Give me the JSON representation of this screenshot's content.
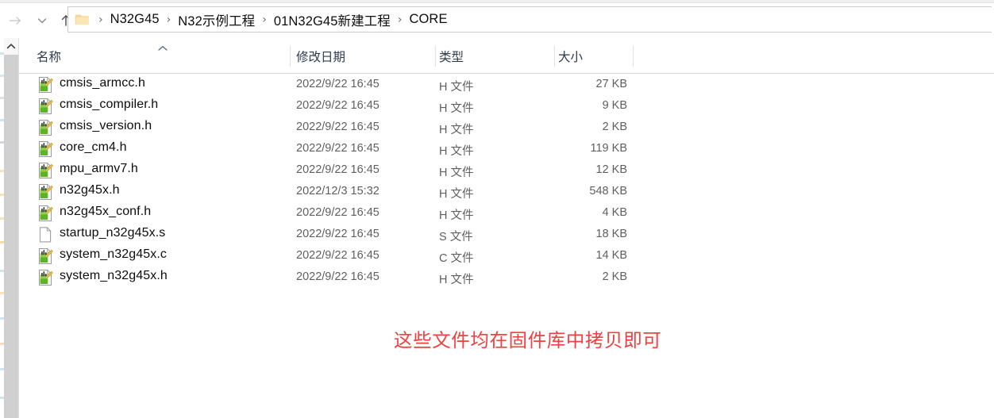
{
  "window": {
    "kind": "windows-file-explorer"
  },
  "toolbar": {
    "back_label": "",
    "forward_label": "",
    "recent_label": "",
    "up_label": "",
    "icons": {
      "forward": "forward-arrow-icon",
      "recent": "chevron-down-icon",
      "up": "up-arrow-icon",
      "folder": "folder-icon"
    }
  },
  "address_bar": {
    "separator": "›",
    "crumbs": [
      {
        "label": "N32G45"
      },
      {
        "label": "N32示例工程"
      },
      {
        "label": "01N32G45新建工程"
      },
      {
        "label": "CORE"
      }
    ]
  },
  "columns": {
    "name": "名称",
    "date_modified": "修改日期",
    "type": "类型",
    "size": "大小",
    "sorted_by": "名称",
    "sort_direction": "ascending"
  },
  "files": [
    {
      "name": "cmsis_armcc.h",
      "date": "2022/9/22 16:45",
      "type": "H 文件",
      "size": "27 KB",
      "icon": "code-file-icon"
    },
    {
      "name": "cmsis_compiler.h",
      "date": "2022/9/22 16:45",
      "type": "H 文件",
      "size": "9 KB",
      "icon": "code-file-icon"
    },
    {
      "name": "cmsis_version.h",
      "date": "2022/9/22 16:45",
      "type": "H 文件",
      "size": "2 KB",
      "icon": "code-file-icon"
    },
    {
      "name": "core_cm4.h",
      "date": "2022/9/22 16:45",
      "type": "H 文件",
      "size": "119 KB",
      "icon": "code-file-icon"
    },
    {
      "name": "mpu_armv7.h",
      "date": "2022/9/22 16:45",
      "type": "H 文件",
      "size": "12 KB",
      "icon": "code-file-icon"
    },
    {
      "name": "n32g45x.h",
      "date": "2022/12/3 15:32",
      "type": "H 文件",
      "size": "548 KB",
      "icon": "code-file-icon"
    },
    {
      "name": "n32g45x_conf.h",
      "date": "2022/9/22 16:45",
      "type": "H 文件",
      "size": "4 KB",
      "icon": "code-file-icon"
    },
    {
      "name": "startup_n32g45x.s",
      "date": "2022/9/22 16:45",
      "type": "S 文件",
      "size": "18 KB",
      "icon": "generic-file-icon"
    },
    {
      "name": "system_n32g45x.c",
      "date": "2022/9/22 16:45",
      "type": "C 文件",
      "size": "14 KB",
      "icon": "code-file-icon"
    },
    {
      "name": "system_n32g45x.h",
      "date": "2022/9/22 16:45",
      "type": "H 文件",
      "size": "2 KB",
      "icon": "code-file-icon"
    }
  ],
  "annotation": {
    "text": "这些文件均在固件库中拷贝即可",
    "color": "#f0403f"
  },
  "colors": {
    "text_primary": "#0d0d0d",
    "text_secondary": "#5f5f5f",
    "header_text": "#2d3b4a",
    "folder_yellow": "#f7d793",
    "code_icon_green": "#61b530",
    "pencil_yellow": "#f2c14a",
    "scrollbar_track": "#d0d0d0",
    "border": "#d6d6d6"
  }
}
